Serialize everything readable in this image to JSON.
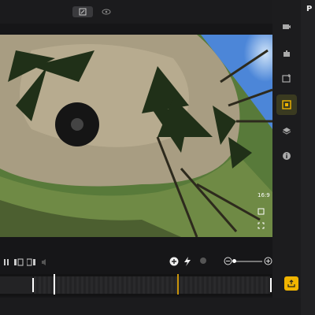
{
  "toolbar": {
    "edit_icon": "edit-icon",
    "preview_icon": "eye-icon"
  },
  "viewport": {
    "aspect_label": "16:9"
  },
  "right_panel": {
    "title_initial": "P"
  },
  "rail": [
    "video-icon",
    "puzzle-icon",
    "image-add-icon",
    "active-effect-icon",
    "layers-icon",
    "info-icon"
  ],
  "timeline": {
    "playhead_fraction": 0.2,
    "marker_fraction": 0.65
  },
  "colors": {
    "accent": "#f0b400",
    "panel": "#1c1c1e",
    "background": "#161618"
  }
}
